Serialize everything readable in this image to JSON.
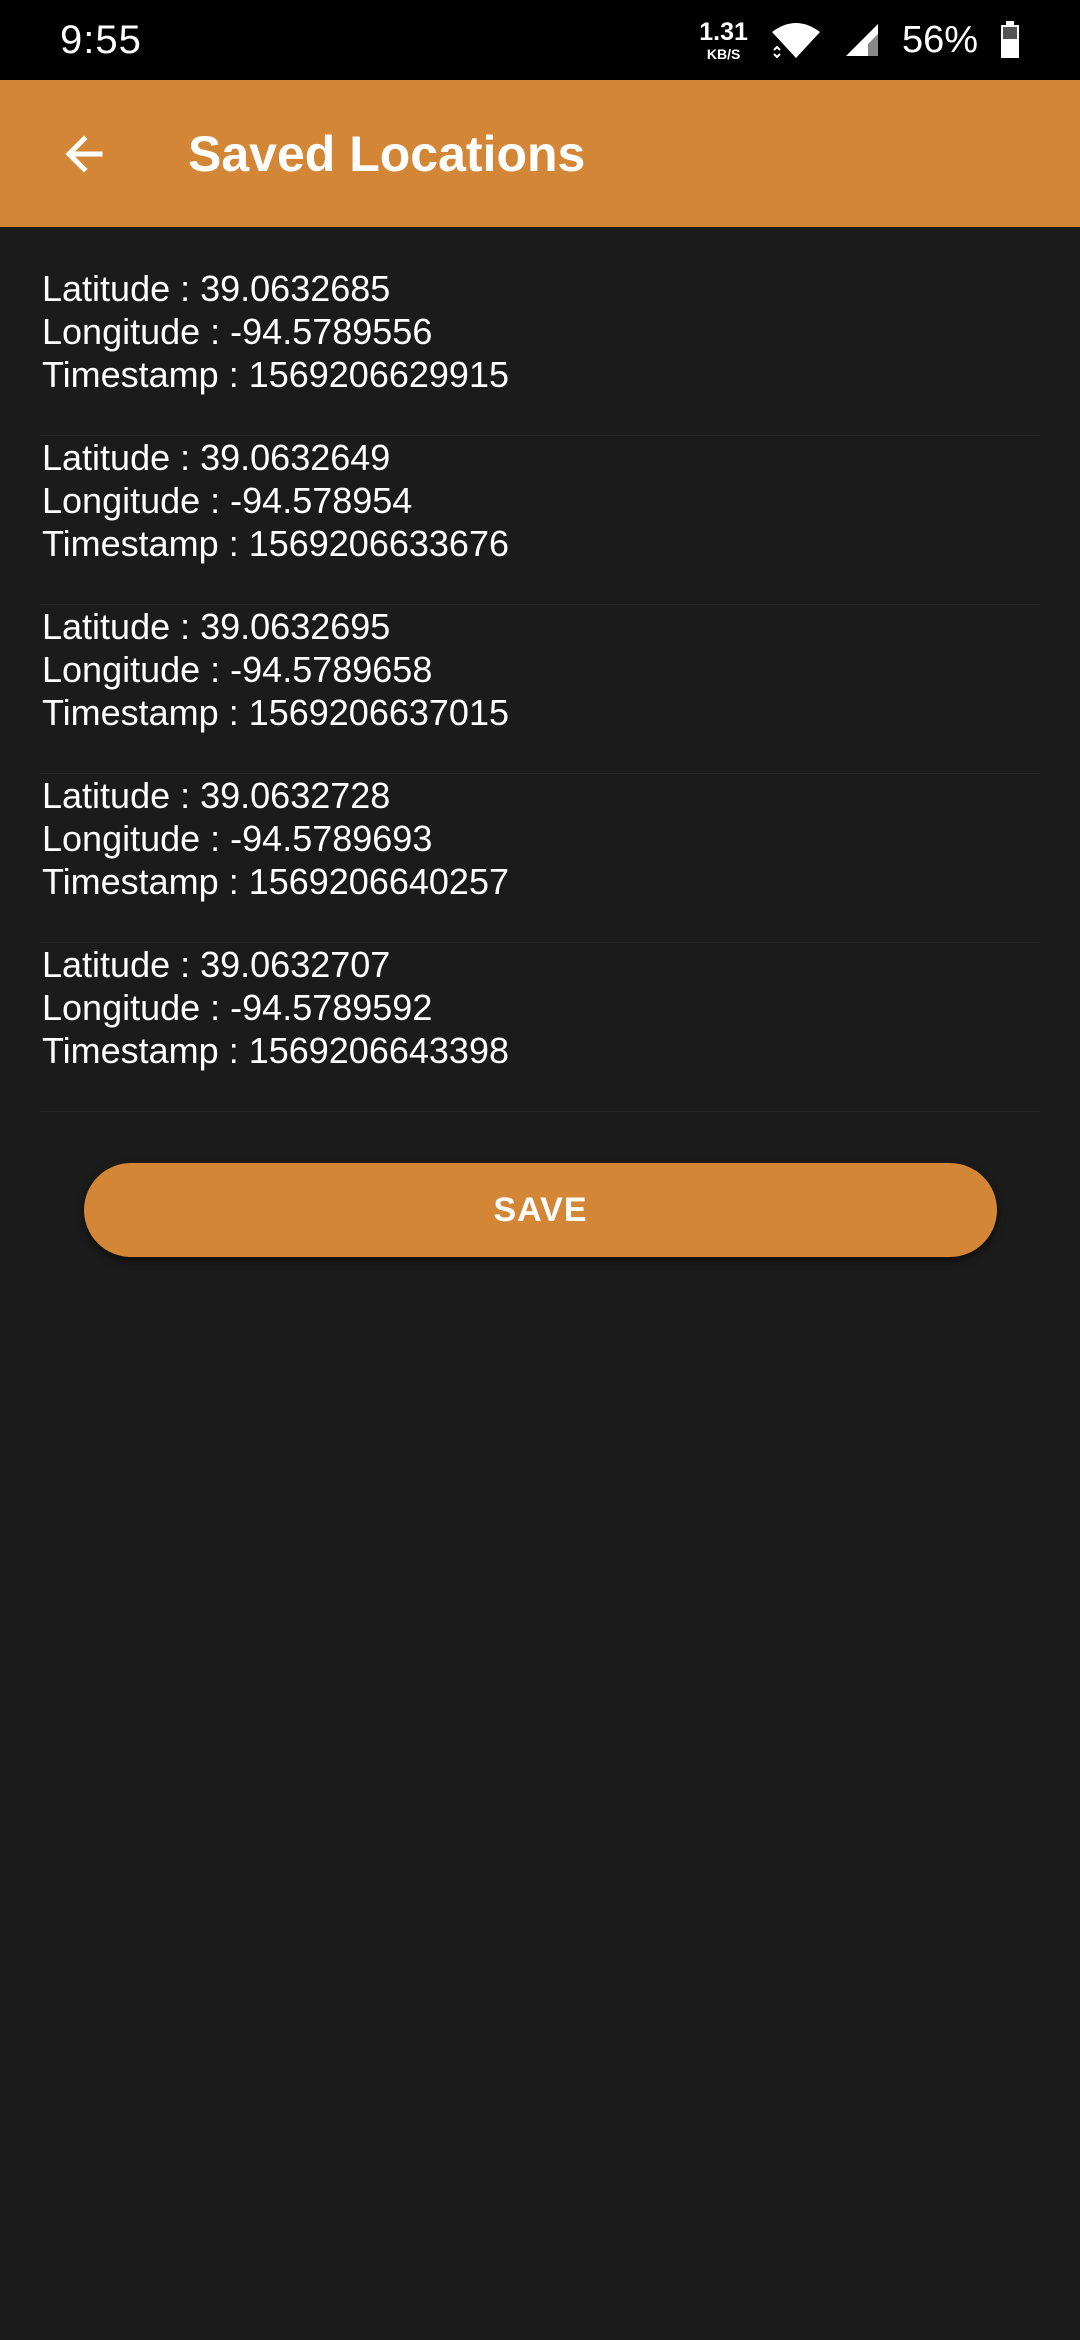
{
  "status_bar": {
    "time": "9:55",
    "net_speed_value": "1.31",
    "net_speed_unit": "KB/S",
    "battery_percent": "56%",
    "icons": [
      "wifi-icon",
      "cell-signal-icon",
      "battery-icon"
    ]
  },
  "app_bar": {
    "back_icon": "arrow-left-icon",
    "title": "Saved Locations",
    "color": "#d38736"
  },
  "locations": [
    {
      "latitude": "Latitude : 39.0632685",
      "longitude": "Longitude : -94.5789556",
      "timestamp": "Timestamp : 1569206629915"
    },
    {
      "latitude": "Latitude : 39.0632649",
      "longitude": "Longitude : -94.578954",
      "timestamp": "Timestamp : 1569206633676"
    },
    {
      "latitude": "Latitude : 39.0632695",
      "longitude": "Longitude : -94.5789658",
      "timestamp": "Timestamp : 1569206637015"
    },
    {
      "latitude": "Latitude : 39.0632728",
      "longitude": "Longitude : -94.5789693",
      "timestamp": "Timestamp : 1569206640257"
    },
    {
      "latitude": "Latitude : 39.0632707",
      "longitude": "Longitude : -94.5789592",
      "timestamp": "Timestamp : 1569206643398"
    }
  ],
  "save_button": {
    "label": "SAVE",
    "color": "#d38736"
  },
  "theme": {
    "background": "#1b1b1b",
    "status_bar": "#000000",
    "text": "#ffffff"
  }
}
